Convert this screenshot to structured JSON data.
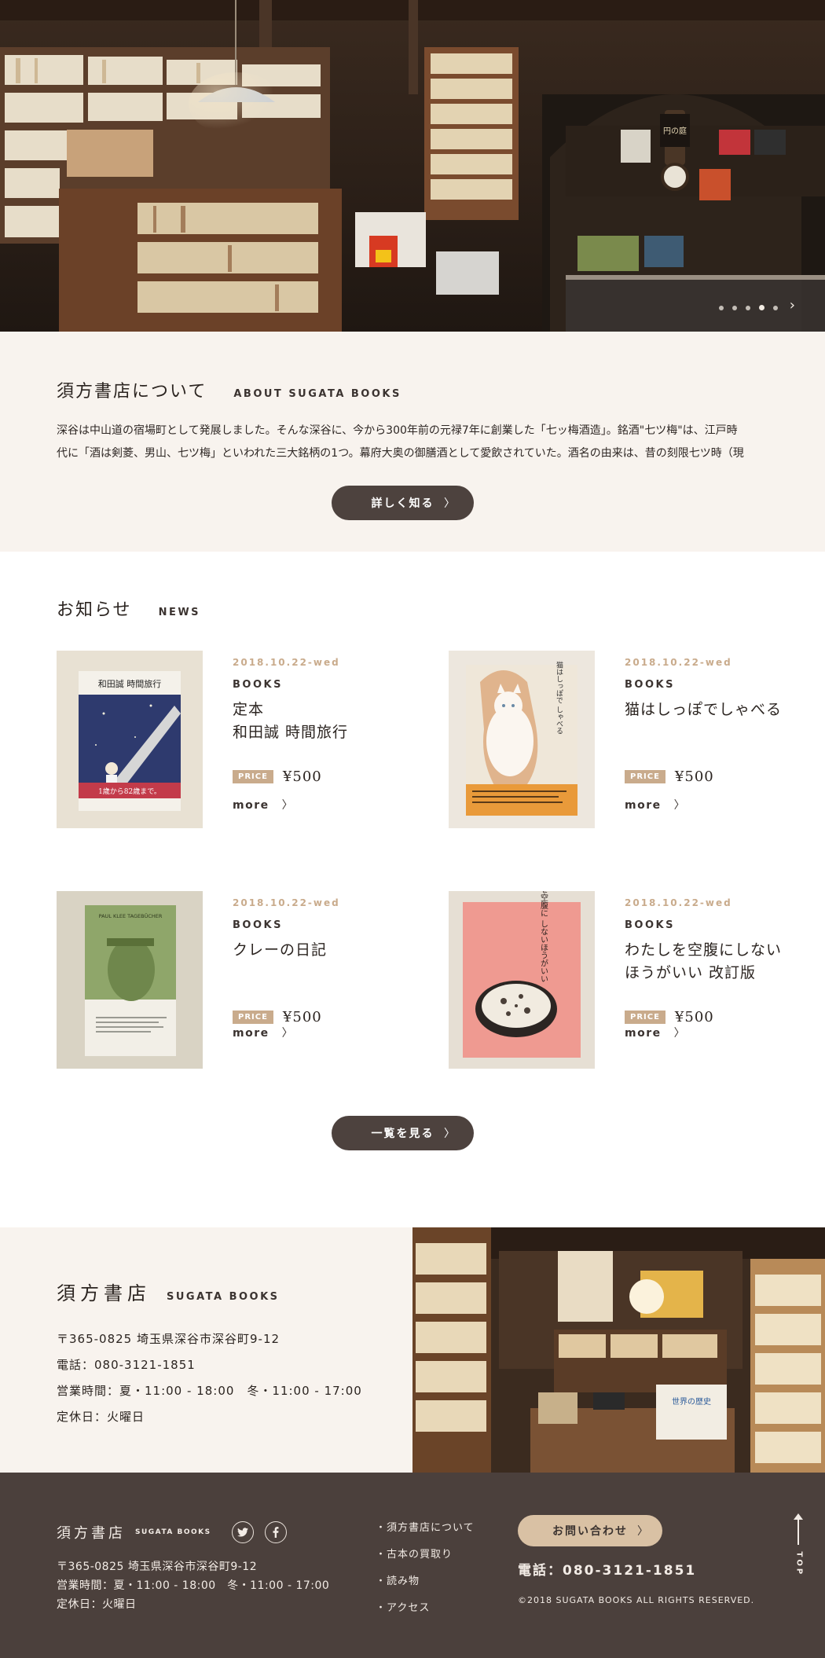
{
  "hero": {
    "slide_count": 5,
    "active_slide": 4,
    "next_glyph": "›",
    "sign_text": "円の庭"
  },
  "about": {
    "title": "須方書店について",
    "title_en": "ABOUT SUGATA BOOKS",
    "body_line1": "深谷は中山道の宿場町として発展しました。そんな深谷に、今から300年前の元禄7年に創業した「七ッ梅酒造」。銘酒\"七ツ梅\"は、江戸時",
    "body_line2": "代に「酒は剣菱、男山、七ツ梅」といわれた三大銘柄の1つ。幕府大奥の御膳酒として愛飲されていた。酒名の由来は、昔の刻限七ツ時（現",
    "button_label": "詳しく知る",
    "chev": "〉"
  },
  "news": {
    "title": "お知らせ",
    "title_en": "NEWS",
    "price_tag": "PRICE",
    "more_label": "more",
    "chev": "〉",
    "items": [
      {
        "date": "2018.10.22-wed",
        "category": "BOOKS",
        "title_line1": "定本",
        "title_line2": "和田誠 時間旅行",
        "price": "¥500",
        "cover_title": "和田誠 時間旅行",
        "cover_band": "1歳から82歳まで。"
      },
      {
        "date": "2018.10.22-wed",
        "category": "BOOKS",
        "title_line1": "猫はしっぽでしゃべる",
        "title_line2": "",
        "price": "¥500",
        "cover_title": "猫はしっぽで しゃべる"
      },
      {
        "date": "2018.10.22-wed",
        "category": "BOOKS",
        "title_line1": "クレーの日記",
        "title_line2": "",
        "price": "¥500",
        "cover_title": "PAUL KLEE TAGEBÜCHER"
      },
      {
        "date": "2018.10.22-wed",
        "category": "BOOKS",
        "title_line1": "わたしを空腹にしない",
        "title_line2": "ほうがいい 改訂版",
        "price": "¥500",
        "cover_title": "わたしを空腹に しないほうがいい"
      }
    ],
    "list_button_label": "一覧を見る"
  },
  "shop": {
    "name": "須方書店",
    "name_en": "SUGATA BOOKS",
    "postal_address": "〒365-0825 埼玉県深谷市深谷町9-12",
    "phone": "電話：080-3121-1851",
    "hours": "営業時間：夏・11:00 - 18:00　冬・11:00 - 17:00",
    "closed": "定休日：火曜日",
    "poster_text": "世界の歴史"
  },
  "footer": {
    "brand": "須方書店",
    "brand_en": "SUGATA BOOKS",
    "address": "〒365-0825 埼玉県深谷市深谷町9-12",
    "hours": "営業時間：夏・11:00 - 18:00　冬・11:00 - 17:00",
    "closed": "定休日：火曜日",
    "nav": [
      "・須方書店について",
      "・古本の買取り",
      "・読み物",
      "・アクセス"
    ],
    "contact_label": "お問い合わせ",
    "chev": "〉",
    "tel": "電話：080-3121-1851",
    "copyright": "©2018 SUGATA BOOKS ALL RIGHTS RESERVED.",
    "top_label": "TOP"
  },
  "colors": {
    "about_bg": "#f8f3ee",
    "button_dark": "#4d423e",
    "accent_tan": "#c9ab8c",
    "footer_bg": "#4b403c",
    "contact_btn": "#d9c1a4"
  },
  "icons": [
    "twitter-icon",
    "facebook-icon",
    "chevron-right-icon",
    "arrow-up-icon"
  ]
}
